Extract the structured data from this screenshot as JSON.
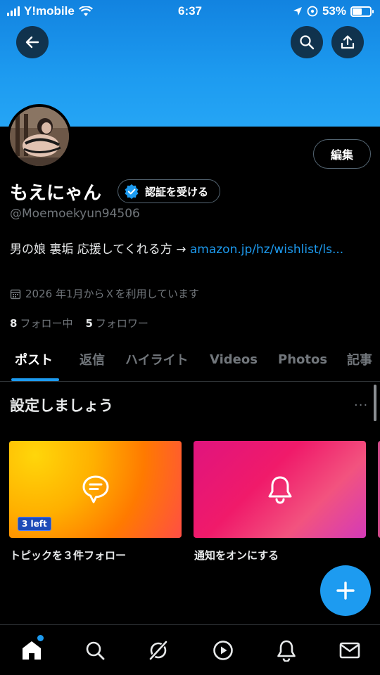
{
  "status_bar": {
    "carrier": "Y!mobile",
    "time": "6:37",
    "battery_percent": "53%",
    "battery_level": 0.53
  },
  "header": {
    "back_icon": "arrow-left-icon",
    "search_icon": "search-icon",
    "share_icon": "share-icon"
  },
  "profile": {
    "edit_label": "編集",
    "name": "もえにゃん",
    "verify_label": "認証を受ける",
    "handle": "@Moemoekyun94506",
    "bio_text": "男の娘 裏垢 応援してくれる方 → ",
    "bio_link": "amazon.jp/hz/wishlist/ls...",
    "joined": "2026 年1月からＸを利用しています",
    "following_count": "8",
    "following_label": "フォロー中",
    "followers_count": "5",
    "followers_label": "フォロワー"
  },
  "tabs": [
    {
      "label": "ポスト",
      "active": true
    },
    {
      "label": "返信",
      "active": false
    },
    {
      "label": "ハイライト",
      "active": false
    },
    {
      "label": "Videos",
      "active": false
    },
    {
      "label": "Photos",
      "active": false
    },
    {
      "label": "記事",
      "active": false
    }
  ],
  "setup": {
    "title": "設定しましょう",
    "more": "···",
    "cards": [
      {
        "label": "トピックを３件フォロー",
        "badge": "3 left",
        "icon": "topic-bubble-icon"
      },
      {
        "label": "通知をオンにする",
        "icon": "bell-icon"
      }
    ]
  },
  "fab": {
    "icon": "plus-icon"
  },
  "bottom_nav": [
    {
      "icon": "home-icon",
      "active": true
    },
    {
      "icon": "search-icon"
    },
    {
      "icon": "grok-icon"
    },
    {
      "icon": "video-play-icon"
    },
    {
      "icon": "notifications-bell-icon"
    },
    {
      "icon": "mail-icon"
    }
  ],
  "colors": {
    "accent": "#1d9bf0",
    "background": "#000000",
    "muted_text": "#71767b"
  }
}
